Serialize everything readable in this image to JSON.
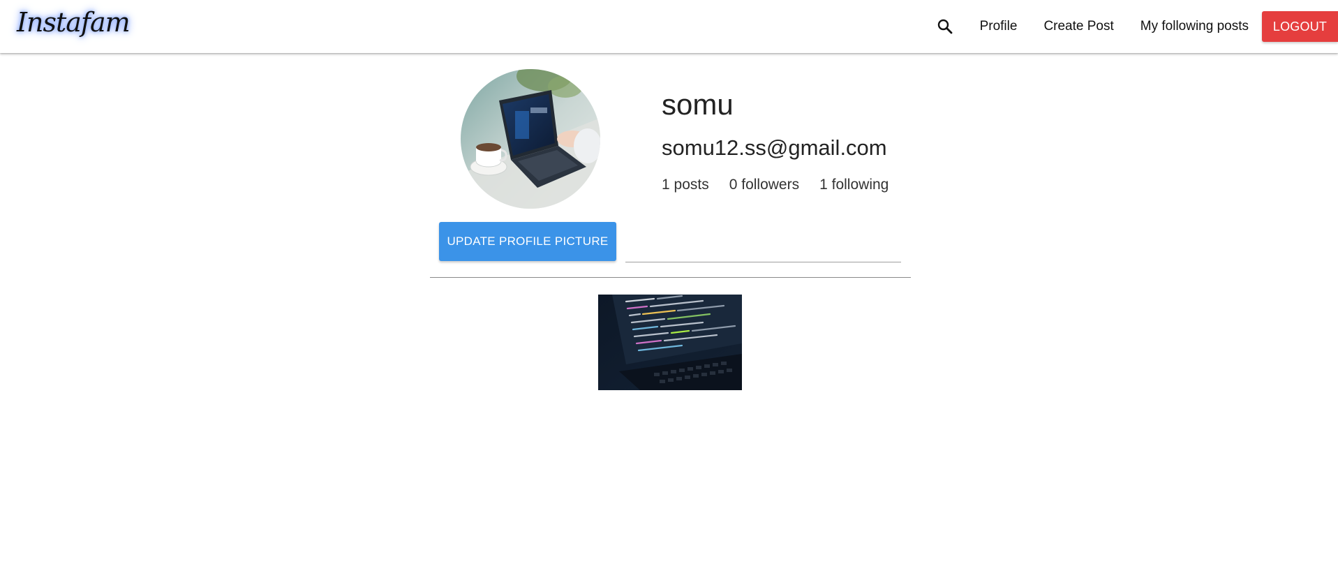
{
  "navbar": {
    "brand": "Instafam",
    "links": {
      "profile": "Profile",
      "create_post": "Create Post",
      "following_posts": "My following posts"
    },
    "logout_label": "LOGOUT",
    "search_icon": "search-icon",
    "colors": {
      "logout": "#e53e3e",
      "brand_glow": "#6f92ff"
    }
  },
  "profile": {
    "username": "somu",
    "email": "somu12.ss@gmail.com",
    "stats": {
      "posts": "1 posts",
      "followers": "0 followers",
      "following": "1 following"
    },
    "update_button_label": "UPDATE PROFILE PICTURE",
    "file_path_value": "",
    "colors": {
      "update_button": "#3b93e8"
    }
  },
  "gallery": {
    "post_count": 1
  }
}
